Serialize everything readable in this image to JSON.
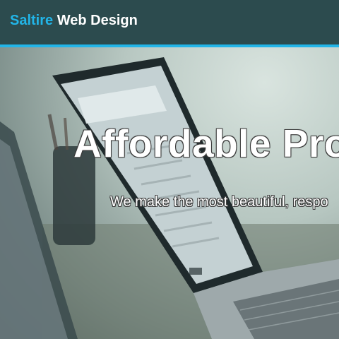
{
  "header": {
    "brand_accent": "Saltire",
    "brand_rest": "Web Design"
  },
  "hero": {
    "headline": "Affordable Pro",
    "subheadline": "We make the most beautiful, respo"
  },
  "colors": {
    "header_bg": "#2c4b4e",
    "accent": "#22b5e8",
    "text": "#ffffff"
  }
}
